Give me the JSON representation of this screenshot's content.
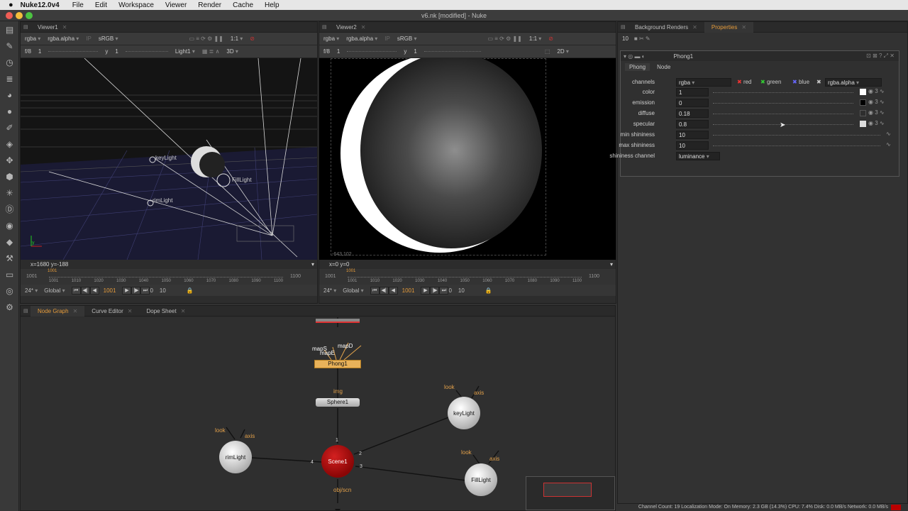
{
  "menubar": {
    "apple": "",
    "app": "Nuke12.0v4",
    "items": [
      "File",
      "Edit",
      "Workspace",
      "Viewer",
      "Render",
      "Cache",
      "Help"
    ]
  },
  "window": {
    "title": "v6.nk [modified] - Nuke"
  },
  "viewer1": {
    "tab": "Viewer1",
    "channels": "rgba",
    "alpha": "rgba.alpha",
    "colorspace": "sRGB",
    "zoom": "1:1",
    "fstop": "f/8",
    "frame": "1",
    "gamma_label": "y",
    "gamma": "1",
    "camera": "Light1",
    "mode": "3D",
    "info": "x=1680 y=-188",
    "labels": {
      "key": "keyLight",
      "rim": "rimLight",
      "fill": "FillLight"
    },
    "timeline": {
      "start": "1001",
      "end": "1100",
      "current_marker": "1001",
      "ticks": [
        "1001",
        "1010",
        "1020",
        "1030",
        "1040",
        "1050",
        "1060",
        "1070",
        "1080",
        "1090",
        "1100"
      ]
    },
    "playback": {
      "fps": "24*",
      "scope": "Global",
      "current_frame": "1001",
      "inc_a": "0",
      "inc_b": "10"
    }
  },
  "viewer2": {
    "tab": "Viewer2",
    "channels": "rgba",
    "alpha": "rgba.alpha",
    "colorspace": "sRGB",
    "zoom": "1:1",
    "fstop": "f/8",
    "frame": "1",
    "gamma_label": "y",
    "gamma": "1",
    "mode": "2D",
    "corner_label": "-643,102",
    "info": "x=0 y=0",
    "timeline": {
      "start": "1001",
      "end": "1100",
      "current_marker": "1001",
      "ticks": [
        "1001",
        "1010",
        "1020",
        "1030",
        "1040",
        "1050",
        "1060",
        "1070",
        "1080",
        "1090",
        "1100"
      ]
    },
    "playback": {
      "fps": "24*",
      "scope": "Global",
      "current_frame": "1001",
      "inc_a": "0",
      "inc_b": "10"
    }
  },
  "bottom_tabs": [
    "Node Graph",
    "Curve Editor",
    "Dope Sheet"
  ],
  "nodegraph": {
    "phong": "Phong1",
    "phong_inputs": [
      "mapS",
      "mapE",
      "mapD"
    ],
    "img_label": "img",
    "sphere": "Sphere1",
    "scene": "Scene1",
    "scene_output": "obj/scn",
    "scene_inputs": [
      "1",
      "2",
      "3",
      "4"
    ],
    "keylight": "keyLight",
    "rimlight": "rimLight",
    "filllight": "FillLight",
    "look": "look",
    "axis": "axis"
  },
  "properties": {
    "tabs": [
      "Background Renders",
      "Properties"
    ],
    "count": "10",
    "node_name": "Phong1",
    "subtabs": [
      "Phong",
      "Node"
    ],
    "channels_label": "channels",
    "channels_value": "rgba",
    "red": "red",
    "green": "green",
    "blue": "blue",
    "alpha": "rgba.alpha",
    "rows": [
      {
        "label": "color",
        "value": "1"
      },
      {
        "label": "emission",
        "value": "0"
      },
      {
        "label": "diffuse",
        "value": "0.18"
      },
      {
        "label": "specular",
        "value": "0.8"
      },
      {
        "label": "min shininess",
        "value": "10"
      },
      {
        "label": "max shininess",
        "value": "10"
      }
    ],
    "shininess_channel_label": "shininess channel",
    "shininess_channel_value": "luminance"
  },
  "status": "Channel Count: 19  Localization Mode: On  Memory: 2.3 GB (14.3%)  CPU: 7.4%  Disk: 0.0 MB/s  Network: 0.0 MB/s",
  "colors": {
    "accent": "#e59b3a",
    "scene_node": "#a00c0c",
    "phong_node": "#e8b25a"
  }
}
